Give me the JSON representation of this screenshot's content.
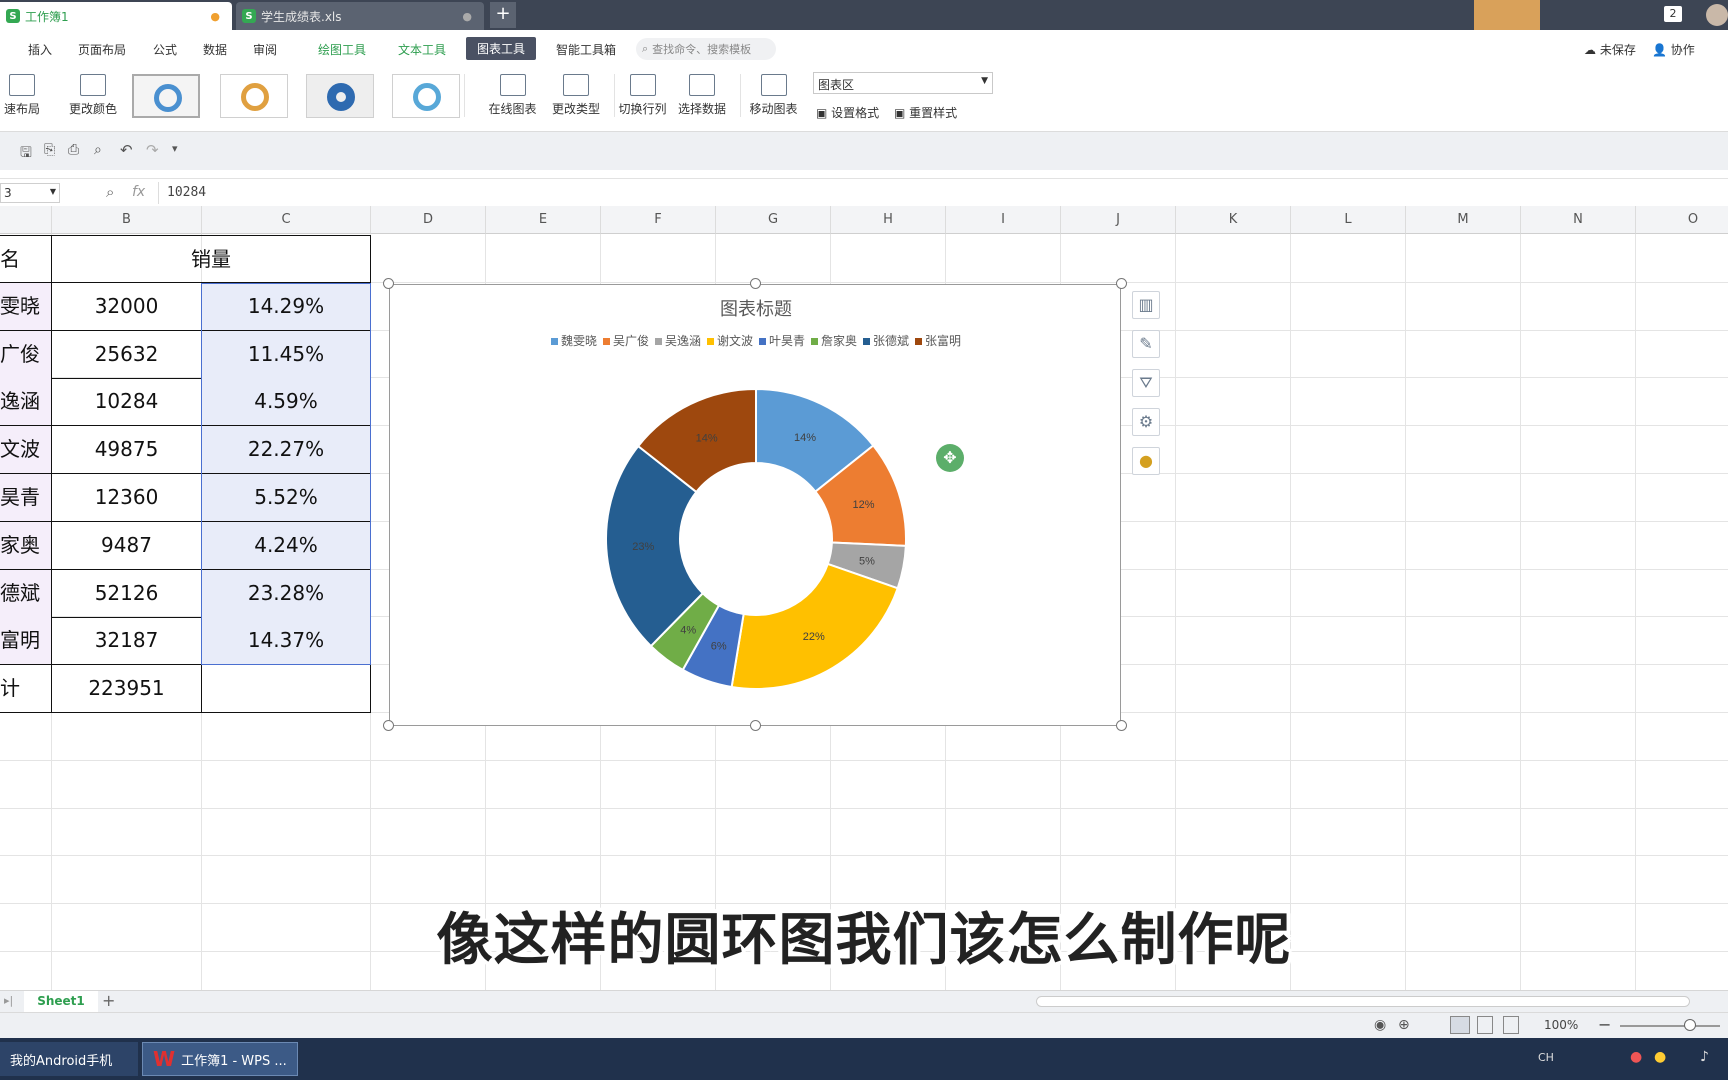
{
  "tabs": {
    "doc1": "工作簿1",
    "doc2": "学生成绩表.xls",
    "new": "+",
    "notif_count": "2"
  },
  "menu": {
    "insert": "插入",
    "page_layout": "页面布局",
    "formula": "公式",
    "data": "数据",
    "review": "审阅",
    "draw_tools": "绘图工具",
    "text_tools": "文本工具",
    "chart_tools": "图表工具",
    "smart_tools": "智能工具箱",
    "search_placeholder": "查找命令、搜索模板",
    "unsaved": "未保存",
    "collab": "协作"
  },
  "ribbon": {
    "quick_layout": "速布局",
    "change_color": "更改颜色",
    "online_chart": "在线图表",
    "change_type": "更改类型",
    "switch_rowcol": "切换行列",
    "select_data": "选择数据",
    "move_chart": "移动图表",
    "chart_area": "图表区",
    "set_format": "设置格式",
    "reset_style": "重置样式"
  },
  "formula": {
    "cell_ref": "3",
    "fx": "fx",
    "value": "10284"
  },
  "columns": [
    "B",
    "C",
    "D",
    "E",
    "F",
    "G",
    "H",
    "I",
    "J",
    "K",
    "L",
    "M",
    "N",
    "O"
  ],
  "table": {
    "header_a": "名",
    "header_b": "销量",
    "rows": [
      {
        "name": "雯晓",
        "sales": "32000",
        "pct": "14.29%"
      },
      {
        "name": "广俊",
        "sales": "25632",
        "pct": "11.45%"
      },
      {
        "name": "逸涵",
        "sales": "10284",
        "pct": "4.59%"
      },
      {
        "name": "文波",
        "sales": "49875",
        "pct": "22.27%"
      },
      {
        "name": "昊青",
        "sales": "12360",
        "pct": "5.52%"
      },
      {
        "name": "家奥",
        "sales": "9487",
        "pct": "4.24%"
      },
      {
        "name": "德斌",
        "sales": "52126",
        "pct": "23.28%"
      },
      {
        "name": "富明",
        "sales": "32187",
        "pct": "14.37%"
      }
    ],
    "total_label": "计",
    "total": "223951"
  },
  "chart_data": {
    "type": "pie",
    "donut": true,
    "title": "图表标题",
    "legend_position": "top",
    "categories": [
      "魏雯晓",
      "吴广俊",
      "吴逸涵",
      "谢文波",
      "叶昊青",
      "詹家奥",
      "张德斌",
      "张富明"
    ],
    "values": [
      32000,
      25632,
      10284,
      49875,
      12360,
      9487,
      52126,
      32187
    ],
    "labels": [
      "14%",
      "12%",
      "5%",
      "22%",
      "6%",
      "4%",
      "23%",
      "14%"
    ],
    "colors": [
      "#5b9bd5",
      "#ed7d31",
      "#a5a5a5",
      "#ffc000",
      "#4472c4",
      "#70ad47",
      "#255e91",
      "#9e480e"
    ]
  },
  "sheet": {
    "name": "Sheet1",
    "add": "+",
    "zoom": "100%"
  },
  "taskbar": {
    "app1": "我的Android手机",
    "app2": "工作簿1 - WPS ...",
    "ime": "CH"
  },
  "subtitle": "像这样的圆环图我们该怎么制作呢"
}
